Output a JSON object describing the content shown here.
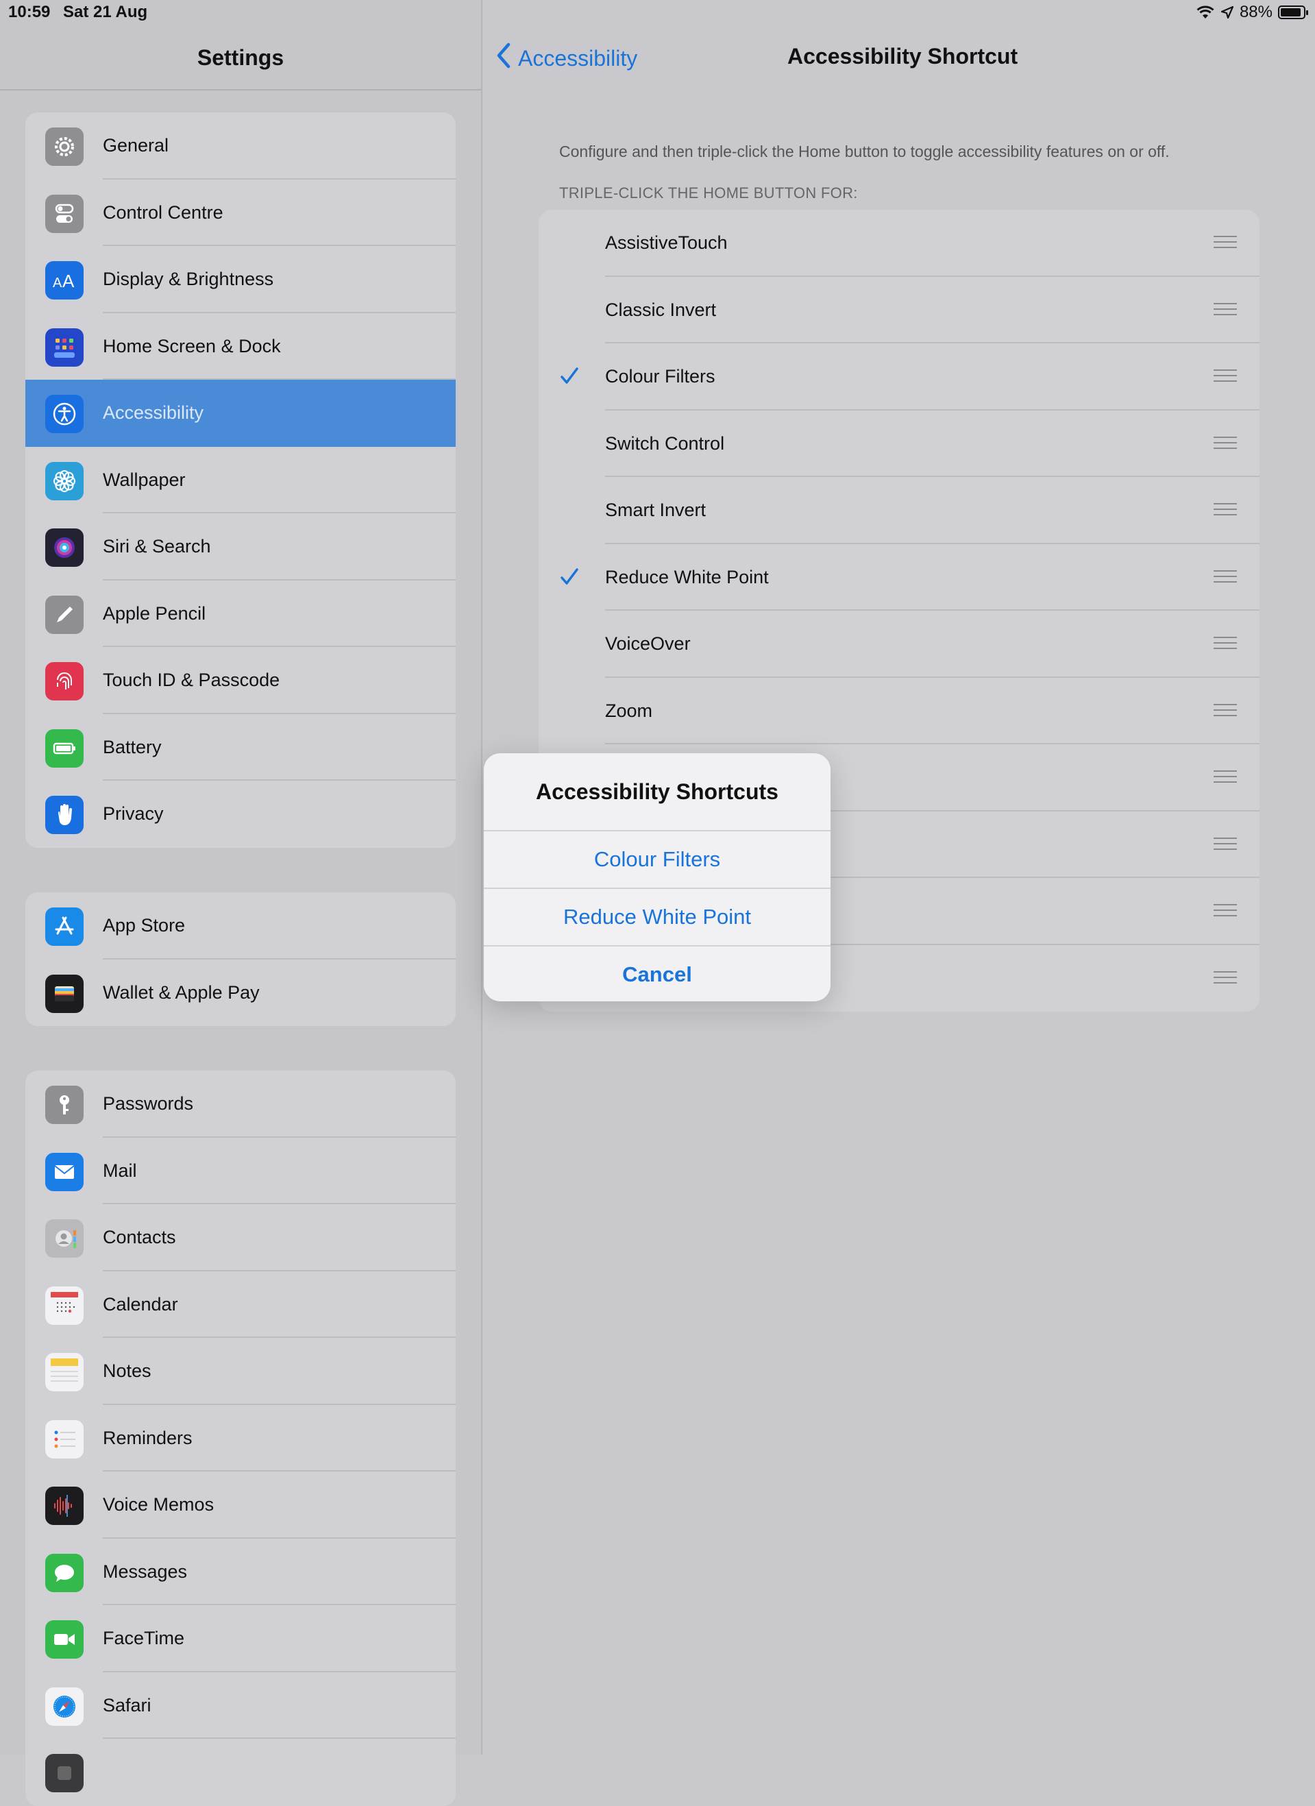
{
  "status": {
    "time": "10:59",
    "date": "Sat 21 Aug",
    "battery": "88%"
  },
  "sidebar": {
    "title": "Settings",
    "groups": [
      [
        {
          "label": "General",
          "icon": "gear-icon",
          "color": "#8e8e93"
        },
        {
          "label": "Control Centre",
          "icon": "toggles-icon",
          "color": "#8e8e93"
        },
        {
          "label": "Display & Brightness",
          "icon": "text-size-icon",
          "color": "#1a6fe0"
        },
        {
          "label": "Home Screen & Dock",
          "icon": "app-grid-icon",
          "color": "#2446c9"
        },
        {
          "label": "Accessibility",
          "icon": "accessibility-icon",
          "color": "#1a6fe0",
          "selected": true
        },
        {
          "label": "Wallpaper",
          "icon": "flower-icon",
          "color": "#2a9fd8"
        },
        {
          "label": "Siri & Search",
          "icon": "siri-icon",
          "color": "#222233"
        },
        {
          "label": "Apple Pencil",
          "icon": "pencil-icon",
          "color": "#8e8e93"
        },
        {
          "label": "Touch ID & Passcode",
          "icon": "fingerprint-icon",
          "color": "#e0344f"
        },
        {
          "label": "Battery",
          "icon": "battery-icon",
          "color": "#34b94d"
        },
        {
          "label": "Privacy",
          "icon": "hand-icon",
          "color": "#1a6fe0"
        }
      ],
      [
        {
          "label": "App Store",
          "icon": "app-store-icon",
          "color": "#1a8ae8"
        },
        {
          "label": "Wallet & Apple Pay",
          "icon": "wallet-icon",
          "color": "#1c1c1e"
        }
      ],
      [
        {
          "label": "Passwords",
          "icon": "key-icon",
          "color": "#8e8e93"
        },
        {
          "label": "Mail",
          "icon": "envelope-icon",
          "color": "#1a7ee6"
        },
        {
          "label": "Contacts",
          "icon": "contacts-icon",
          "color": "#b9b9bd"
        },
        {
          "label": "Calendar",
          "icon": "calendar-icon",
          "color": "#f2f2f4"
        },
        {
          "label": "Notes",
          "icon": "notes-icon",
          "color": "#f2f2f4"
        },
        {
          "label": "Reminders",
          "icon": "reminders-icon",
          "color": "#f2f2f4"
        },
        {
          "label": "Voice Memos",
          "icon": "waveform-icon",
          "color": "#1c1c1e"
        },
        {
          "label": "Messages",
          "icon": "message-bubble-icon",
          "color": "#34b94d"
        },
        {
          "label": "FaceTime",
          "icon": "video-camera-icon",
          "color": "#34b94d"
        },
        {
          "label": "Safari",
          "icon": "compass-icon",
          "color": "#f2f2f4"
        },
        {
          "label": "",
          "icon": "generic-app-icon",
          "color": "#3a3a3c"
        }
      ]
    ]
  },
  "detail": {
    "back_label": "Accessibility",
    "title": "Accessibility Shortcut",
    "description": "Configure and then triple-click the Home button to toggle accessibility features on or off.",
    "section_header": "TRIPLE-CLICK THE HOME BUTTON FOR:",
    "items": [
      {
        "label": "AssistiveTouch",
        "checked": false
      },
      {
        "label": "Classic Invert",
        "checked": false
      },
      {
        "label": "Colour Filters",
        "checked": true
      },
      {
        "label": "Switch Control",
        "checked": false
      },
      {
        "label": "Smart Invert",
        "checked": false
      },
      {
        "label": "Reduce White Point",
        "checked": true
      },
      {
        "label": "VoiceOver",
        "checked": false
      },
      {
        "label": "Zoom",
        "checked": false
      },
      {
        "label": "",
        "checked": false
      },
      {
        "label": "",
        "checked": false
      },
      {
        "label": "",
        "checked": false
      },
      {
        "label": "",
        "checked": false
      }
    ]
  },
  "sheet": {
    "title": "Accessibility Shortcuts",
    "options": [
      "Colour Filters",
      "Reduce White Point"
    ],
    "cancel": "Cancel"
  },
  "colors": {
    "accent": "#1a73d9",
    "selected_row": "#4a8bd8"
  }
}
